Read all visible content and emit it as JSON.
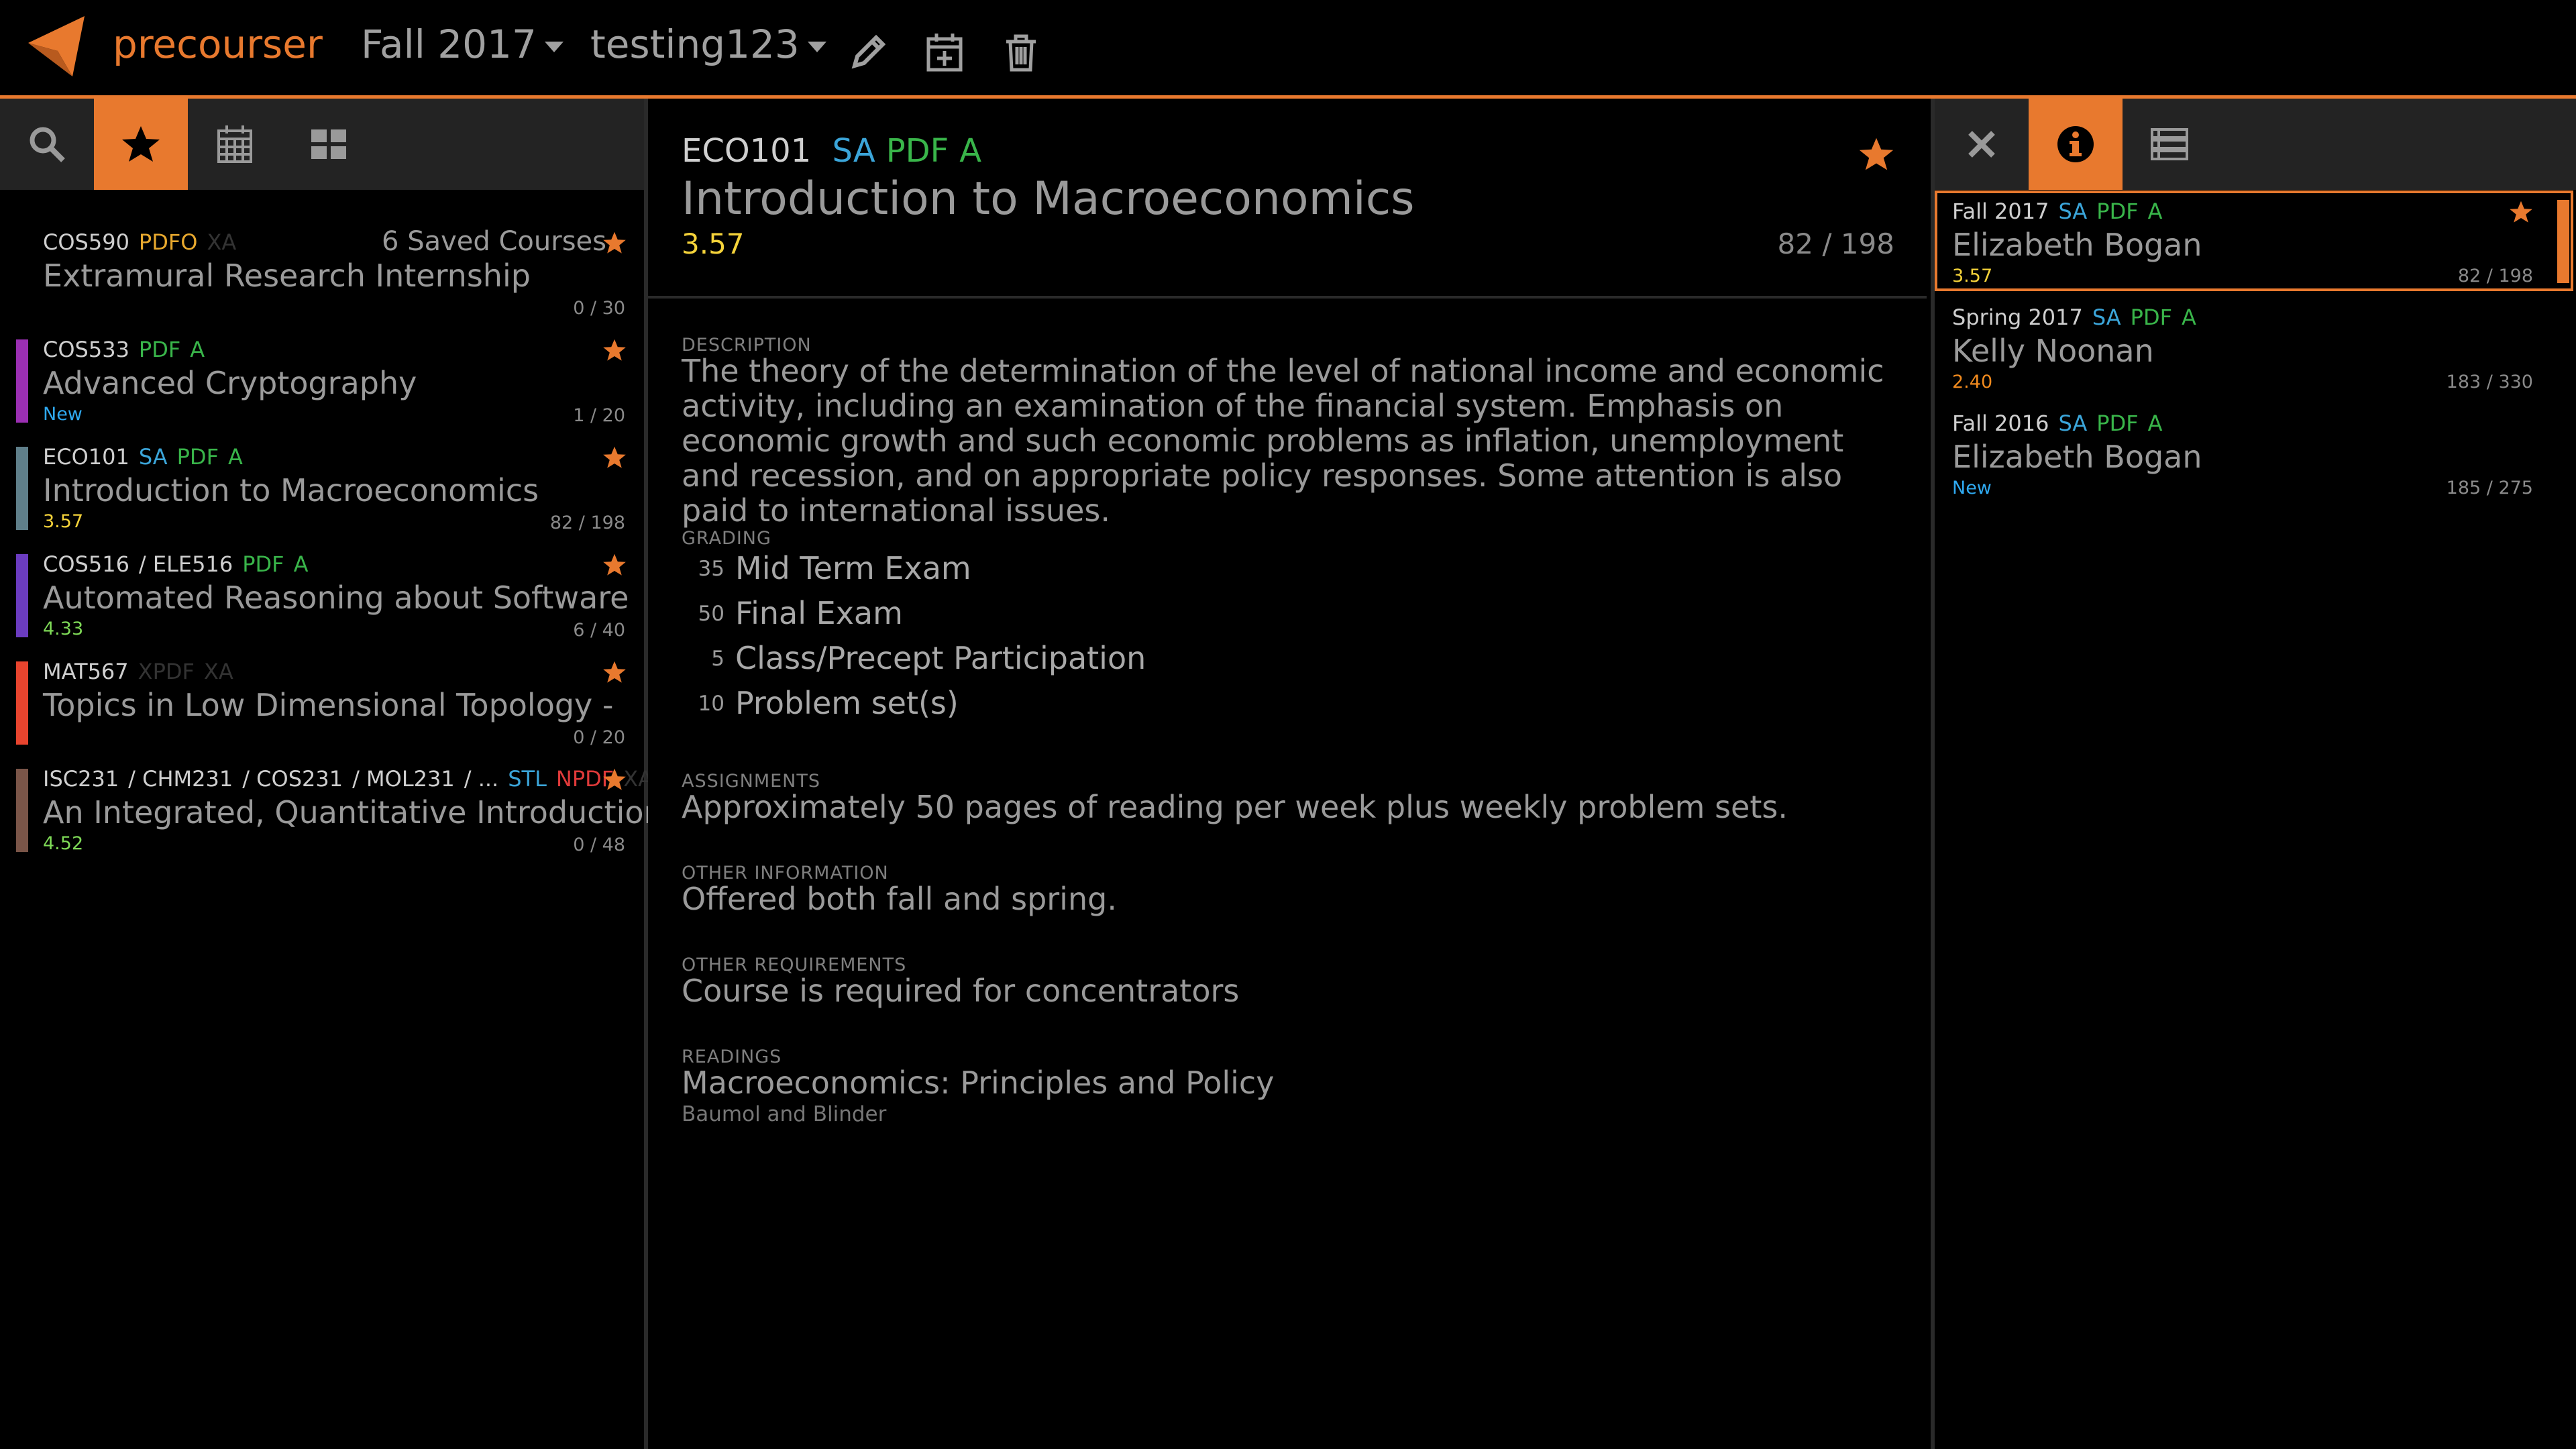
{
  "colors": {
    "accent": "#e8792e",
    "rating_yellow": "#f5d33a",
    "rating_green": "#7ed957",
    "rating_orange": "#f08a1e",
    "new_blue": "#2fa9f0"
  },
  "navbar": {
    "brand": "precourser",
    "semester": "Fall 2017",
    "schedule": "testing123",
    "icons": [
      "logo-icon",
      "pencil-icon",
      "calendar-plus-icon",
      "trash-icon"
    ]
  },
  "left": {
    "toolbar": [
      "search-icon",
      "star-icon",
      "calendar-icon",
      "grid-icon"
    ],
    "saved_count": "6 Saved Courses",
    "courses": [
      {
        "code": "COS590",
        "tags": [
          {
            "t": "PDFO",
            "c": "t-pdfo"
          },
          {
            "t": "XA",
            "c": "t-xa"
          }
        ],
        "title": "Extramural Research Internship",
        "score": "",
        "enroll": "0 / 30",
        "bar": ""
      },
      {
        "code": "COS533",
        "tags": [
          {
            "t": "PDF",
            "c": "t-pdf"
          },
          {
            "t": "A",
            "c": "t-a"
          }
        ],
        "title": "Advanced Cryptography",
        "score": "New",
        "enroll": "1 / 20",
        "bar": "#9b2fb3"
      },
      {
        "code": "ECO101",
        "tags": [
          {
            "t": "SA",
            "c": "t-sa"
          },
          {
            "t": "PDF",
            "c": "t-pdf"
          },
          {
            "t": "A",
            "c": "t-a"
          }
        ],
        "title": "Introduction to Macroeconomics",
        "score": "3.57",
        "enroll": "82 / 198",
        "bar": "#5f7f8a"
      },
      {
        "code": "COS516",
        "tags": [
          {
            "t": "/ ELE516",
            "c": "t-list"
          },
          {
            "t": "PDF",
            "c": "t-pdf"
          },
          {
            "t": "A",
            "c": "t-a"
          }
        ],
        "title": "Automated Reasoning about Software",
        "score": "4.33",
        "enroll": "6 / 40",
        "bar": "#6b3cc0"
      },
      {
        "code": "MAT567",
        "tags": [
          {
            "t": "XPDF",
            "c": "t-xpdf"
          },
          {
            "t": "XA",
            "c": "t-xa"
          }
        ],
        "title": "Topics in Low Dimensional Topology -",
        "score": "",
        "enroll": "0 / 20",
        "bar": "#e8442e"
      },
      {
        "code": "ISC231",
        "tags": [
          {
            "t": "/ CHM231",
            "c": "t-list"
          },
          {
            "t": "/ COS231",
            "c": "t-list"
          },
          {
            "t": "/ MOL231",
            "c": "t-list"
          },
          {
            "t": "/ ...",
            "c": "t-list"
          },
          {
            "t": "STL",
            "c": "t-stl"
          },
          {
            "t": "NPDF",
            "c": "t-npdf"
          },
          {
            "t": "XA",
            "c": "t-xa"
          }
        ],
        "title": "An Integrated, Quantitative Introduction",
        "score": "4.52",
        "enroll": "0 / 48",
        "bar": "#7a5548"
      }
    ]
  },
  "center": {
    "code": "ECO101",
    "tags": [
      {
        "t": "SA",
        "c": "t-sa"
      },
      {
        "t": "PDF",
        "c": "t-pdf"
      },
      {
        "t": "A",
        "c": "t-a"
      }
    ],
    "title": "Introduction to Macroeconomics",
    "rating": "3.57",
    "enroll": "82 / 198",
    "description_label": "DESCRIPTION",
    "description": "The theory of the determination of the level of national income and economic activity, including an examination of the financial system. Emphasis on economic growth and such economic problems as inflation, unemployment and recession, and on appropriate policy responses. Some attention is also paid to international issues.",
    "grading_label": "GRADING",
    "grading": [
      {
        "pct": "35",
        "name": "Mid Term Exam"
      },
      {
        "pct": "50",
        "name": "Final Exam"
      },
      {
        "pct": "5",
        "name": "Class/Precept Participation"
      },
      {
        "pct": "10",
        "name": "Problem set(s)"
      }
    ],
    "assignments_label": "ASSIGNMENTS",
    "assignments": "Approximately 50 pages of reading per week plus weekly problem sets.",
    "other_info_label": "OTHER INFORMATION",
    "other_info": "Offered both fall and spring.",
    "other_req_label": "OTHER REQUIREMENTS",
    "other_req": "Course is required for concentrators",
    "readings_label": "READINGS",
    "reading_title": "Macroeconomics: Principles and Policy",
    "reading_author": "Baumol and Blinder"
  },
  "right": {
    "toolbar": [
      "close-icon",
      "info-icon",
      "list-icon"
    ],
    "semesters": [
      {
        "term": "Fall 2017",
        "tags": [
          {
            "t": "SA",
            "c": "t-sa"
          },
          {
            "t": "PDF",
            "c": "t-pdf"
          },
          {
            "t": "A",
            "c": "t-a"
          }
        ],
        "prof": "Elizabeth Bogan",
        "score": "3.57",
        "enroll": "82 / 198",
        "active": true
      },
      {
        "term": "Spring 2017",
        "tags": [
          {
            "t": "SA",
            "c": "t-sa"
          },
          {
            "t": "PDF",
            "c": "t-pdf"
          },
          {
            "t": "A",
            "c": "t-a"
          }
        ],
        "prof": "Kelly Noonan",
        "score": "2.40",
        "enroll": "183 / 330",
        "active": false
      },
      {
        "term": "Fall 2016",
        "tags": [
          {
            "t": "SA",
            "c": "t-sa"
          },
          {
            "t": "PDF",
            "c": "t-pdf"
          },
          {
            "t": "A",
            "c": "t-a"
          }
        ],
        "prof": "Elizabeth Bogan",
        "score": "New",
        "enroll": "185 / 275",
        "active": false
      }
    ]
  }
}
